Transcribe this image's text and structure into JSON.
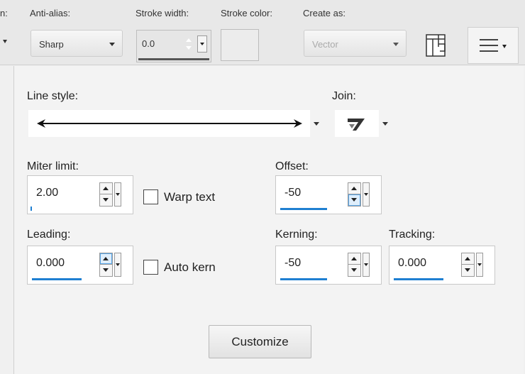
{
  "toolbar": {
    "cut_label": "n:",
    "anti_alias_label": "Anti-alias:",
    "anti_alias_value": "Sharp",
    "stroke_width_label": "Stroke width:",
    "stroke_width_value": "0.0",
    "stroke_color_label": "Stroke color:",
    "create_as_label": "Create as:",
    "create_as_value": "Vector",
    "icons": [
      "convert-to-path-icon",
      "hamburger-menu-icon"
    ]
  },
  "panel": {
    "line_style_label": "Line style:",
    "join_label": "Join:",
    "miter_limit_label": "Miter limit:",
    "miter_limit_value": "2.00",
    "warp_text_label": "Warp text",
    "warp_text_checked": false,
    "offset_label": "Offset:",
    "offset_value": "-50",
    "leading_label": "Leading:",
    "leading_value": "0.000",
    "auto_kern_label": "Auto kern",
    "auto_kern_checked": false,
    "kerning_label": "Kerning:",
    "kerning_value": "-50",
    "tracking_label": "Tracking:",
    "tracking_value": "0.000",
    "customize_label": "Customize"
  },
  "colors": {
    "accent": "#1f7fd1",
    "panel_bg": "#f3f3f3",
    "toolbar_bg": "#e8e8e8"
  }
}
